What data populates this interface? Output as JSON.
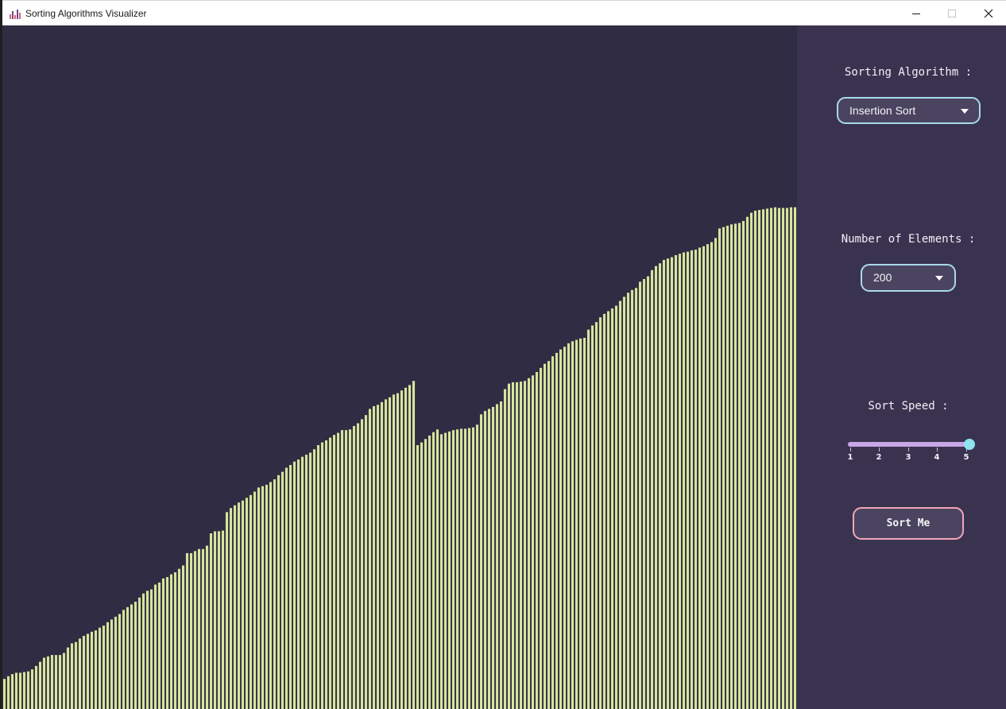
{
  "window": {
    "title": "Sorting Algorithms Visualizer",
    "app_icon": "bar-chart-icon",
    "controls": [
      "minimize-icon",
      "maximize-icon",
      "close-icon"
    ]
  },
  "colors": {
    "bar": "#d7e59c",
    "canvas_background": "#302c44",
    "sidebar_background": "#3a3350",
    "select_border": "#a9d9ea",
    "button_border": "#f2a6b8",
    "slider_track": "#c9a6e8",
    "slider_thumb": "#8fe3f0"
  },
  "sidebar": {
    "algorithm_label": "Sorting Algorithm :",
    "algorithm_value": "Insertion Sort",
    "count_label": "Number of Elements :",
    "count_value": "200",
    "speed_label": "Sort Speed :",
    "speed_value": 5,
    "speed_ticks": [
      "1",
      "2",
      "3",
      "4",
      "5"
    ],
    "sort_button": "Sort Me"
  },
  "chart_data": {
    "type": "bar",
    "count": 200,
    "ylim": [
      0,
      1000
    ],
    "values": [
      44,
      48,
      51,
      53,
      53,
      54,
      55,
      58,
      63,
      69,
      75,
      77,
      79,
      79,
      79,
      82,
      90,
      96,
      98,
      103,
      107,
      110,
      113,
      115,
      119,
      122,
      127,
      131,
      135,
      139,
      145,
      149,
      153,
      157,
      163,
      169,
      173,
      175,
      182,
      185,
      191,
      193,
      197,
      200,
      205,
      210,
      228,
      228,
      231,
      234,
      234,
      239,
      257,
      260,
      260,
      261,
      288,
      294,
      298,
      302,
      305,
      309,
      313,
      318,
      324,
      326,
      328,
      332,
      336,
      342,
      347,
      353,
      357,
      362,
      365,
      369,
      372,
      375,
      380,
      386,
      390,
      393,
      397,
      401,
      404,
      408,
      408,
      409,
      414,
      418,
      424,
      430,
      439,
      443,
      445,
      449,
      453,
      456,
      460,
      462,
      466,
      470,
      474,
      480,
      386,
      390,
      395,
      400,
      405,
      409,
      402,
      404,
      406,
      408,
      409,
      410,
      410,
      411,
      412,
      416,
      431,
      436,
      439,
      442,
      446,
      450,
      468,
      476,
      478,
      478,
      479,
      480,
      484,
      488,
      493,
      499,
      505,
      509,
      516,
      521,
      526,
      530,
      535,
      538,
      540,
      542,
      543,
      555,
      561,
      566,
      573,
      578,
      582,
      586,
      590,
      597,
      603,
      609,
      613,
      616,
      625,
      629,
      633,
      642,
      648,
      652,
      657,
      659,
      661,
      664,
      666,
      668,
      669,
      671,
      672,
      675,
      677,
      680,
      683,
      689,
      703,
      705,
      707,
      709,
      710,
      711,
      714,
      720,
      726,
      729,
      730,
      731,
      732,
      733,
      734,
      733,
      733,
      733,
      734,
      734
    ]
  }
}
